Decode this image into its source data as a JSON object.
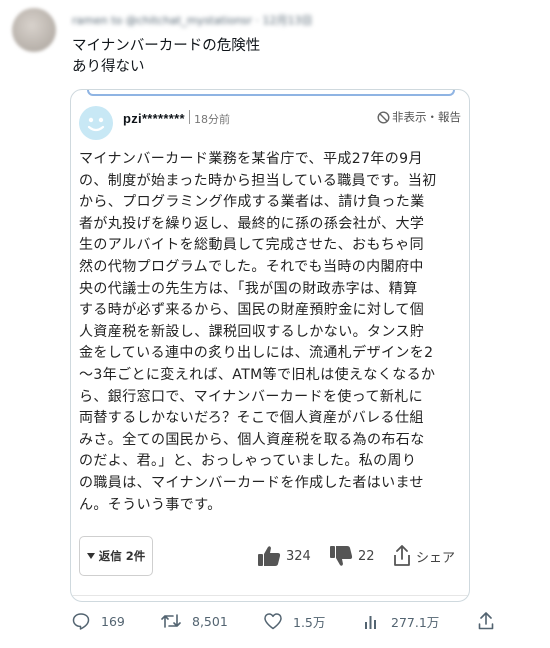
{
  "tweet": {
    "header_blurred": "ramen to  @chitchat_mystationsr · 12月13日",
    "text_line1": "マイナンバーカードの危険性",
    "text_line2": "あり得ない"
  },
  "card": {
    "username": "pzi********",
    "time": "18分前",
    "hide_report": "非表示・報告",
    "body": "マイナンバーカード業務を某省庁で、平成27年の9月\nの、制度が始まった時から担当している職員です。当初\nから、プログラミング作成する業者は、請け負った業\n者が丸投げを繰り返し、最終的に孫の孫会社が、大学\n生のアルバイトを総動員して完成させた、おもちゃ同\n然の代物プログラムでした。それでも当時の内閣府中\n央の代議士の先生方は、「我が国の財政赤字は、精算\nする時が必ず来るから、国民の財産預貯金に対して個\n人資産税を新設し、課税回収するしかない。タンス貯\n金をしている連中の炙り出しには、流通札デザインを2\n〜3年ごとに変えれば、ATM等で旧札は使えなくなるか\nら、銀行窓口で、マイナンバーカードを使って新札に\n両替するしかないだろ？そこで個人資産がバレる仕組\nみさ。全ての国民から、個人資産税を取る為の布石な\nのだよ、君。」と、おっしゃっていました。私の周り\nの職員は、マイナンバーカードを作成した者はいませ\nん。そういう事です。",
    "reply_label": "返信 2件",
    "likes": "324",
    "dislikes": "22",
    "share_label": "シェア"
  },
  "actions": {
    "replies": "169",
    "retweets": "8,501",
    "likes": "1.5万",
    "views": "277.1万"
  },
  "icons": [
    "reply-icon",
    "retweet-icon",
    "heart-icon",
    "views-icon",
    "share-icon",
    "thumbs-up-icon",
    "thumbs-down-icon",
    "prohibited-icon"
  ],
  "colors": {
    "text": "#0f1419",
    "muted": "#536471",
    "border": "#cfd9de",
    "avatar_bg": "#c8e8f5"
  }
}
